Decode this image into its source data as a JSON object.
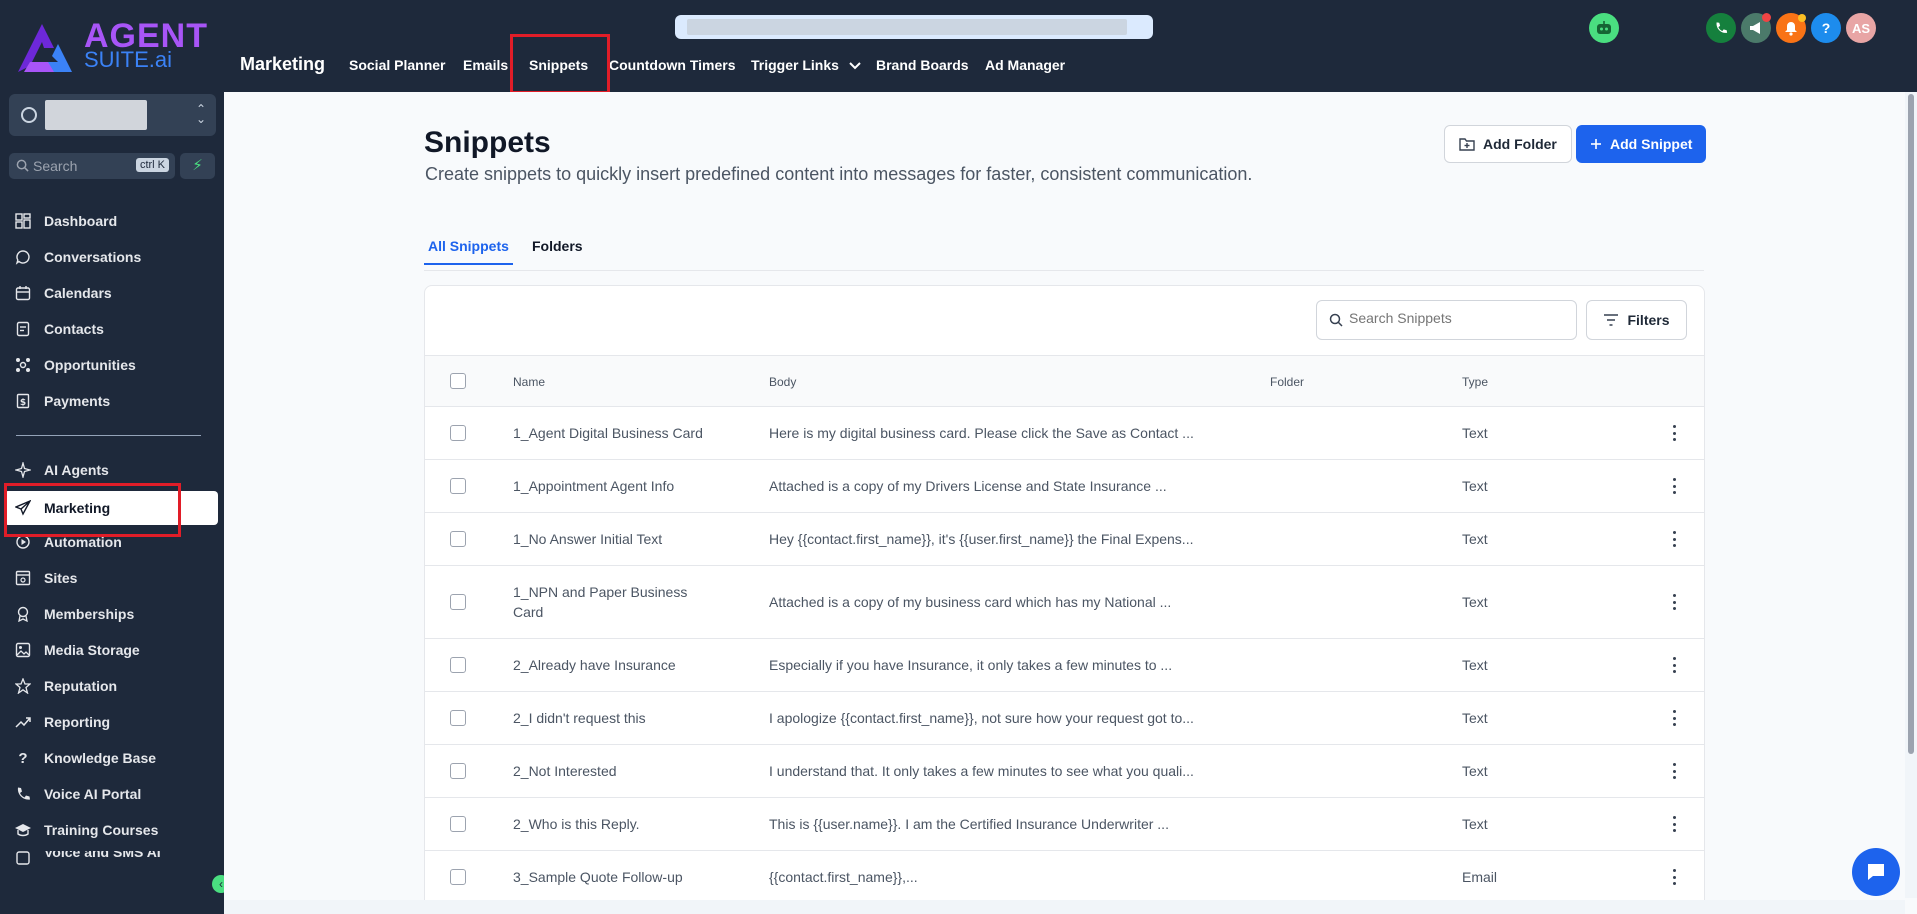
{
  "brand": {
    "line1": "AGENT",
    "line2": "SUITE.ai"
  },
  "sidebar": {
    "search_placeholder": "Search",
    "search_shortcut": "ctrl K",
    "items": [
      {
        "label": "Dashboard",
        "icon": "dashboard-icon"
      },
      {
        "label": "Conversations",
        "icon": "chat-icon"
      },
      {
        "label": "Calendars",
        "icon": "calendar-icon"
      },
      {
        "label": "Contacts",
        "icon": "contacts-icon"
      },
      {
        "label": "Opportunities",
        "icon": "opportunities-icon"
      },
      {
        "label": "Payments",
        "icon": "payments-icon"
      },
      {
        "label": "AI Agents",
        "icon": "sparkle-icon"
      },
      {
        "label": "Marketing",
        "icon": "send-icon"
      },
      {
        "label": "Automation",
        "icon": "automation-icon"
      },
      {
        "label": "Sites",
        "icon": "sites-icon"
      },
      {
        "label": "Memberships",
        "icon": "membership-icon"
      },
      {
        "label": "Media Storage",
        "icon": "image-icon"
      },
      {
        "label": "Reputation",
        "icon": "star-icon"
      },
      {
        "label": "Reporting",
        "icon": "trend-icon"
      },
      {
        "label": "Knowledge Base",
        "icon": "question-icon"
      },
      {
        "label": "Voice AI Portal",
        "icon": "phone-icon"
      },
      {
        "label": "Training Courses",
        "icon": "graduation-cap-icon"
      },
      {
        "label": "Voice and SMS AI",
        "icon": "voice-sms-icon"
      }
    ],
    "active": "Marketing"
  },
  "topnav": {
    "module": "Marketing",
    "tabs": [
      "Social Planner",
      "Emails",
      "Snippets",
      "Countdown Timers",
      "Trigger Links",
      "Brand Boards",
      "Ad Manager"
    ],
    "active_tab": "Snippets",
    "user_initials": "AS",
    "help_label": "?"
  },
  "page": {
    "title": "Snippets",
    "subtitle": "Create snippets to quickly insert predefined content into messages for faster, consistent communication.",
    "add_folder": "Add Folder",
    "add_snippet": "Add Snippet",
    "tabs": [
      "All Snippets",
      "Folders"
    ],
    "search_placeholder": "Search Snippets",
    "filters": "Filters",
    "columns": [
      "Name",
      "Body",
      "Folder",
      "Type"
    ],
    "rows": [
      {
        "name": "1_Agent Digital Business Card",
        "body": "Here is my digital business card. Please click the Save as Contact ...",
        "folder": "",
        "type": "Text"
      },
      {
        "name": "1_Appointment Agent Info",
        "body": "Attached is a copy of my Drivers License and State Insurance ...",
        "folder": "",
        "type": "Text"
      },
      {
        "name": "1_No Answer Initial Text",
        "body": "Hey {{contact.first_name}}, it's {{user.first_name}} the Final Expens...",
        "folder": "",
        "type": "Text"
      },
      {
        "name": "1_NPN and Paper Business Card",
        "body": "Attached is a copy of my business card which has my National ...",
        "folder": "",
        "type": "Text"
      },
      {
        "name": "2_Already have Insurance",
        "body": "Especially if you have Insurance, it only takes a few minutes to ...",
        "folder": "",
        "type": "Text"
      },
      {
        "name": "2_I didn't request this",
        "body": "I apologize {{contact.first_name}}, not sure how your request got to...",
        "folder": "",
        "type": "Text"
      },
      {
        "name": "2_Not Interested",
        "body": "I understand that. It only takes a few minutes to see what you quali...",
        "folder": "",
        "type": "Text"
      },
      {
        "name": "2_Who is this Reply.",
        "body": "This is {{user.name}}. I am the Certified Insurance Underwriter ...",
        "folder": "",
        "type": "Text"
      },
      {
        "name": "3_Sample Quote Follow-up",
        "body": "{{contact.first_name}},...",
        "folder": "",
        "type": "Email"
      }
    ]
  },
  "colors": {
    "sidebar_bg": "#1e293b",
    "accent": "#1d63ed",
    "highlight": "#e11d28"
  }
}
